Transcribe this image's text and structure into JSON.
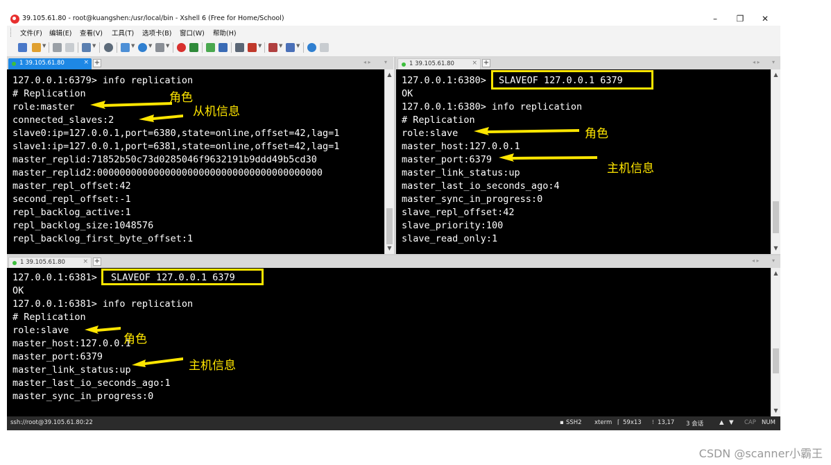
{
  "window": {
    "title": "39.105.61.80 - root@kuangshen:/usr/local/bin - Xshell 6 (Free for Home/School)",
    "minimize": "–",
    "maximize": "❐",
    "close": "✕"
  },
  "menu": [
    "文件(F)",
    "编辑(E)",
    "查看(V)",
    "工具(T)",
    "选项卡(B)",
    "窗口(W)",
    "帮助(H)"
  ],
  "tabs": {
    "left": {
      "label": "1 39.105.61.80",
      "close": "×",
      "add": "+"
    },
    "right": {
      "label": "1 39.105.61.80",
      "close": "×",
      "add": "+"
    },
    "bottom": {
      "label": "1 39.105.61.80",
      "close": "×",
      "add": "+"
    },
    "nav": "◂ ▸"
  },
  "panes": {
    "left": {
      "lines": [
        "127.0.0.1:6379> info replication",
        "# Replication",
        "role:master",
        "connected_slaves:2",
        "slave0:ip=127.0.0.1,port=6380,state=online,offset=42,lag=1",
        "slave1:ip=127.0.0.1,port=6381,state=online,offset=42,lag=1",
        "master_replid:71852b50c73d0285046f9632191b9ddd49b5cd30",
        "master_replid2:0000000000000000000000000000000000000000",
        "master_repl_offset:42",
        "second_repl_offset:-1",
        "repl_backlog_active:1",
        "repl_backlog_size:1048576",
        "repl_backlog_first_byte_offset:1"
      ],
      "notes": [
        "角色",
        "从机信息"
      ]
    },
    "right": {
      "prompt": "127.0.0.1:6380>",
      "command": "SLAVEOF 127.0.0.1 6379",
      "lines": [
        "OK",
        "127.0.0.1:6380> info replication",
        "# Replication",
        "role:slave",
        "master_host:127.0.0.1",
        "master_port:6379",
        "master_link_status:up",
        "master_last_io_seconds_ago:4",
        "master_sync_in_progress:0",
        "slave_repl_offset:42",
        "slave_priority:100",
        "slave_read_only:1"
      ],
      "notes": [
        "角色",
        "主机信息"
      ]
    },
    "bottom": {
      "prompt": "127.0.0.1:6381>",
      "command": "SLAVEOF 127.0.0.1 6379",
      "lines": [
        "OK",
        "127.0.0.1:6381> info replication",
        "# Replication",
        "role:slave",
        "master_host:127.0.0.1",
        "master_port:6379",
        "master_link_status:up",
        "master_last_io_seconds_ago:1",
        "master_sync_in_progress:0"
      ],
      "notes": [
        "角色",
        "主机信息"
      ]
    }
  },
  "statusbar": {
    "address": "ssh://root@39.105.61.80:22",
    "protocol": "SSH2",
    "term": "xterm",
    "size": "59x13",
    "cursor": "13,17",
    "sessions": "3 会话",
    "cap": "CAP",
    "num": "NUM"
  },
  "watermark": "CSDN @scanner小霸王",
  "colors": {
    "annotation": "#ffe600",
    "terminal_bg": "#000000",
    "terminal_fg": "#ffffff",
    "active_tab": "#1e88e5"
  }
}
